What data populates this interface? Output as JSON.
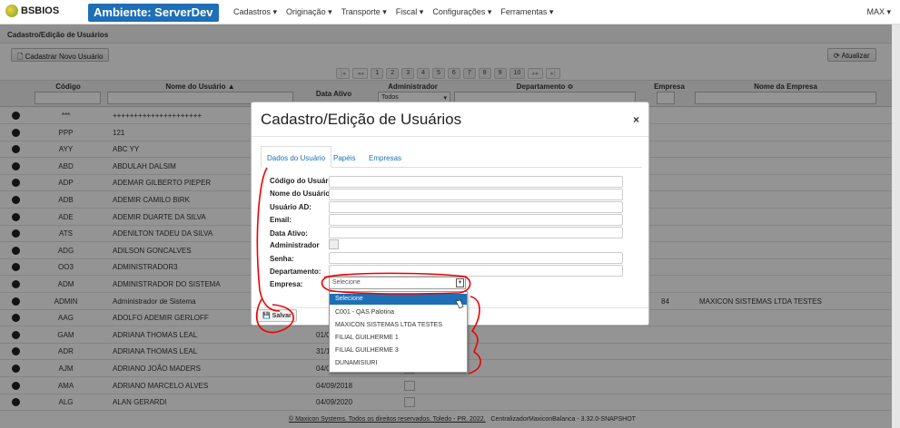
{
  "nav": {
    "logo": "BSBIOS",
    "env": "Ambiente: ServerDev",
    "menu": [
      "Cadastros ▾",
      "Originação ▾",
      "Transporte ▾",
      "Fiscal ▾",
      "Configurações ▾",
      "Ferramentas ▾"
    ],
    "user": "MAX ▾"
  },
  "sub": {
    "title": "Cadastro/Edição de Usuários",
    "new_btn": "Cadastrar Novo Usuário",
    "refresh_btn": "Atualizar"
  },
  "pager": [
    "|◂",
    "◂◂",
    "1",
    "2",
    "3",
    "4",
    "5",
    "6",
    "7",
    "8",
    "9",
    "10",
    "▸▸",
    "▸|"
  ],
  "columns": {
    "codigo": "Código",
    "nome": "Nome do Usuário ▲",
    "data": "Data Ativo",
    "admin": "Administrador",
    "admin_filter": "Todos",
    "depto": "Departamento ≎",
    "empresa": "Empresa",
    "nome_empresa": "Nome da Empresa"
  },
  "rows": [
    {
      "code": "***",
      "name": "+++++++++++++++++++++",
      "date": "",
      "emp": "",
      "emp_name": ""
    },
    {
      "code": "PPP",
      "name": "121",
      "date": "",
      "emp": "",
      "emp_name": ""
    },
    {
      "code": "AYY",
      "name": "ABC YY",
      "date": "",
      "emp": "",
      "emp_name": ""
    },
    {
      "code": "ABD",
      "name": "ABDULAH DALSIM",
      "date": "",
      "emp": "",
      "emp_name": ""
    },
    {
      "code": "ADP",
      "name": "ADEMAR GILBERTO PIEPER",
      "date": "",
      "emp": "",
      "emp_name": ""
    },
    {
      "code": "ADB",
      "name": "ADEMIR CAMILO BIRK",
      "date": "",
      "emp": "",
      "emp_name": ""
    },
    {
      "code": "ADE",
      "name": "ADEMIR DUARTE DA SILVA",
      "date": "",
      "emp": "",
      "emp_name": ""
    },
    {
      "code": "ATS",
      "name": "ADENILTON TADEU DA SILVA",
      "date": "",
      "emp": "",
      "emp_name": ""
    },
    {
      "code": "ADG",
      "name": "ADILSON GONCALVES",
      "date": "",
      "emp": "",
      "emp_name": ""
    },
    {
      "code": "OO3",
      "name": "ADMINISTRADOR3",
      "date": "",
      "emp": "",
      "emp_name": ""
    },
    {
      "code": "ADM",
      "name": "ADMINISTRADOR DO SISTEMA",
      "date": "",
      "emp": "",
      "emp_name": ""
    },
    {
      "code": "ADMIN",
      "name": "Administrador de Sistema",
      "date": "",
      "emp": "84",
      "emp_name": "MAXICON SISTEMAS LTDA TESTES"
    },
    {
      "code": "AAG",
      "name": "ADOLFO ADEMIR GERLOFF",
      "date": "",
      "emp": "",
      "emp_name": ""
    },
    {
      "code": "GAM",
      "name": "ADRIANA THOMAS LEAL",
      "date": "01/0",
      "emp": "",
      "emp_name": ""
    },
    {
      "code": "ADR",
      "name": "ADRIANA THOMAS LEAL",
      "date": "31/1",
      "emp": "",
      "emp_name": ""
    },
    {
      "code": "AJM",
      "name": "ADRIANO JOÃO MADERS",
      "date": "04/09/2018",
      "emp": "",
      "emp_name": ""
    },
    {
      "code": "AMA",
      "name": "ADRIANO MARCELO ALVES",
      "date": "04/09/2018",
      "emp": "",
      "emp_name": ""
    },
    {
      "code": "ALG",
      "name": "ALAN GERARDI",
      "date": "04/09/2020",
      "emp": "",
      "emp_name": ""
    }
  ],
  "footer": {
    "link": "© Maxicon Systems. Todos os direitos reservados. Toledo - PR. 2022.",
    "version": "CentralizadorMaxiconBalanca - 3.32.0-SNAPSHOT"
  },
  "modal": {
    "title": "Cadastro/Edição de Usuários",
    "close": "×",
    "tabs": [
      "Dados do Usuário",
      "Papéis",
      "Empresas"
    ],
    "fields": [
      "Código do Usuário:",
      "Nome do Usuário:",
      "Usuário AD:",
      "Email:",
      "Data Ativo:",
      "Administrador",
      "Senha:",
      "Departamento:",
      "Empresa:"
    ],
    "select_value": "Selecione",
    "save": "Salvar",
    "options": [
      "Selecione",
      "C001 - QAS Palotina",
      "MAXICON SISTEMAS LTDA TESTES",
      "FILIAL GUILHERME 1",
      "FILIAL GUILHERME 3",
      "DUNAMISIURI"
    ]
  }
}
